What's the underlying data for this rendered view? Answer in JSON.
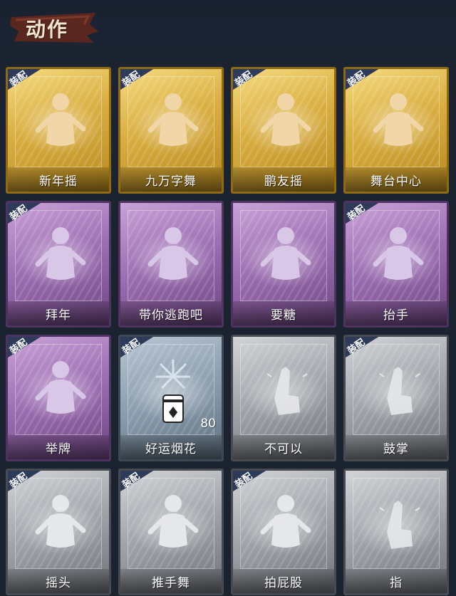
{
  "page": {
    "title": "动作"
  },
  "badge_label": "装配",
  "cards": [
    {
      "name": "新年摇",
      "rarity": "gold",
      "equipped": true,
      "icon": "figure-shaking-icon",
      "count": ""
    },
    {
      "name": "九万字舞",
      "rarity": "gold",
      "equipped": true,
      "icon": "figure-dancing-icon",
      "count": ""
    },
    {
      "name": "鹏友摇",
      "rarity": "gold",
      "equipped": true,
      "icon": "figure-wave-icon",
      "count": ""
    },
    {
      "name": "舞台中心",
      "rarity": "gold",
      "equipped": true,
      "icon": "figure-star-icon",
      "count": ""
    },
    {
      "name": "拜年",
      "rarity": "purple",
      "equipped": true,
      "icon": "figure-bow-icon",
      "count": ""
    },
    {
      "name": "带你逃跑吧",
      "rarity": "purple",
      "equipped": false,
      "icon": "figure-point-icon",
      "count": ""
    },
    {
      "name": "要糖",
      "rarity": "purple",
      "equipped": false,
      "icon": "figure-ask-icon",
      "count": ""
    },
    {
      "name": "抬手",
      "rarity": "purple",
      "equipped": true,
      "icon": "figure-raise-hand-icon",
      "count": ""
    },
    {
      "name": "举牌",
      "rarity": "purple",
      "equipped": true,
      "icon": "figure-sign-icon",
      "count": ""
    },
    {
      "name": "好运烟花",
      "rarity": "blue",
      "equipped": true,
      "icon": "firework-icon",
      "count": "80"
    },
    {
      "name": "不可以",
      "rarity": "gray",
      "equipped": false,
      "icon": "finger-no-icon",
      "count": ""
    },
    {
      "name": "鼓掌",
      "rarity": "gray",
      "equipped": true,
      "icon": "clap-icon",
      "count": ""
    },
    {
      "name": "摇头",
      "rarity": "gray",
      "equipped": true,
      "icon": "figure-shake-head-icon",
      "count": ""
    },
    {
      "name": "推手舞",
      "rarity": "gray",
      "equipped": true,
      "icon": "figure-push-dance-icon",
      "count": ""
    },
    {
      "name": "拍屁股",
      "rarity": "gray",
      "equipped": true,
      "icon": "figure-pat-icon",
      "count": ""
    },
    {
      "name": "指",
      "rarity": "gray",
      "equipped": false,
      "icon": "point-hand-icon",
      "count": ""
    }
  ],
  "colors": {
    "background": "#1b2230",
    "title_banner": "#5a2620",
    "badge": "#2e3a5a",
    "gold": "#d9ad3f",
    "purple": "#9a6cb0",
    "blue": "#8a9cad",
    "gray": "#9ea2a8"
  }
}
